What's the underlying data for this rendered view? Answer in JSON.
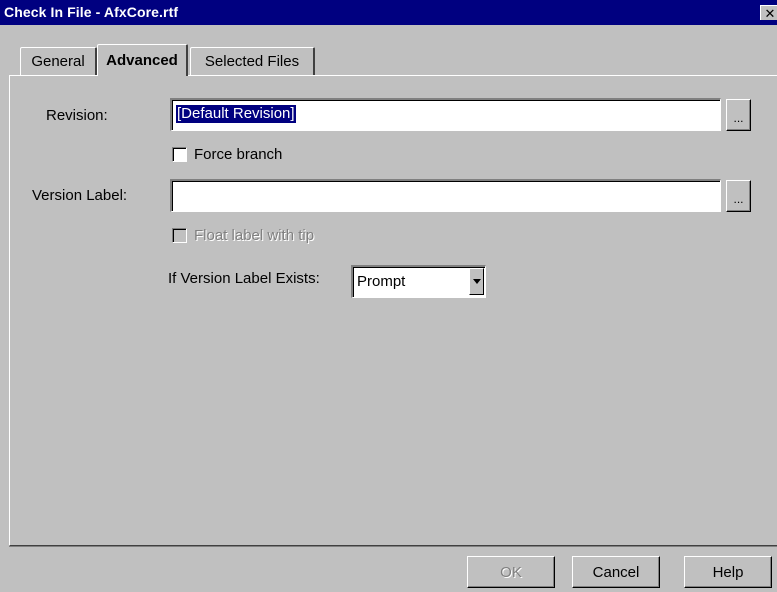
{
  "window": {
    "title": "Check In File - AfxCore.rtf",
    "close_glyph": "✕"
  },
  "tabs": [
    {
      "label": "General"
    },
    {
      "label": "Advanced",
      "active": true
    },
    {
      "label": "Selected Files"
    }
  ],
  "form": {
    "revision": {
      "label": "Revision:",
      "value": "[Default Revision]",
      "browse_label": "..."
    },
    "force_branch": {
      "label": "Force branch",
      "checked": false
    },
    "version_label": {
      "label": "Version Label:",
      "value": "",
      "browse_label": "..."
    },
    "float_label": {
      "label": "Float label with tip",
      "checked": false,
      "enabled": false
    },
    "if_exists": {
      "label": "If Version Label Exists:",
      "selected": "Prompt"
    }
  },
  "buttons": {
    "ok": "OK",
    "cancel": "Cancel",
    "help": "Help"
  },
  "colors": {
    "titlebar": "#000080",
    "face": "#c0c0c0",
    "selection": "#000080"
  },
  "icons": {
    "close": "close-icon",
    "dropdown": "chevron-down-icon"
  }
}
